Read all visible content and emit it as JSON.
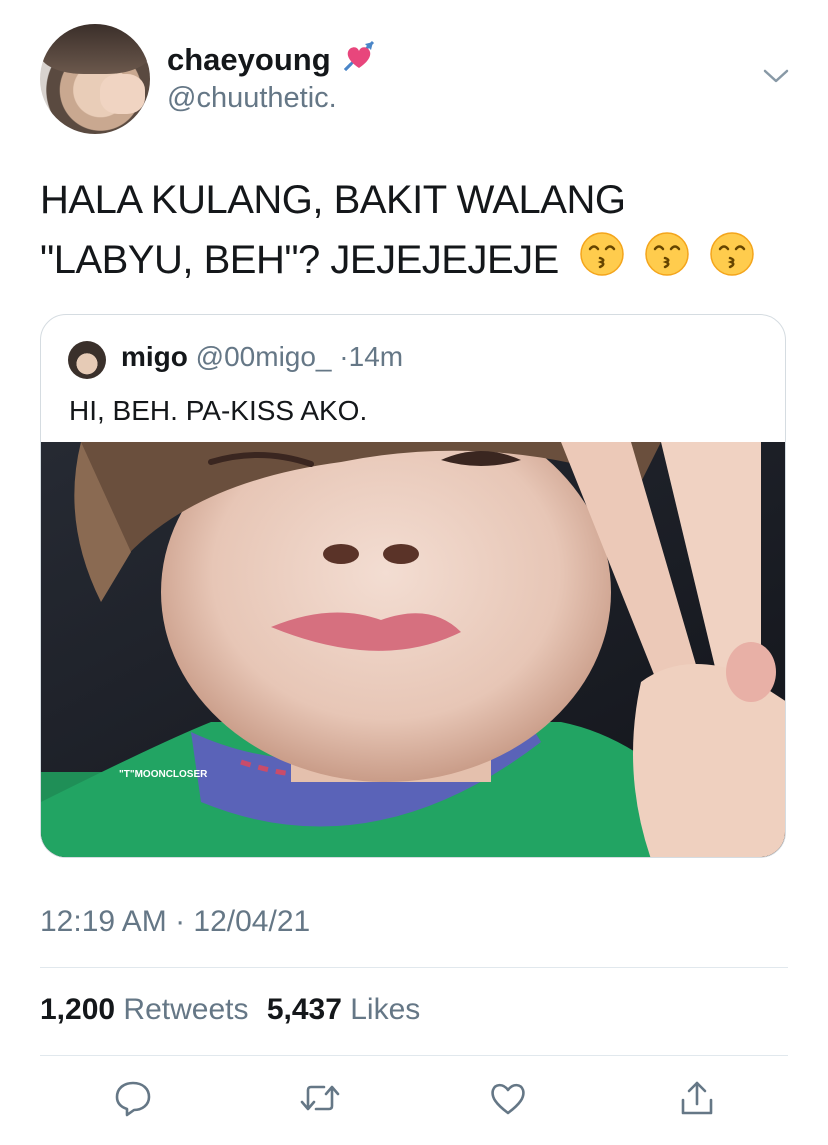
{
  "author": {
    "display_name": "chaeyoung",
    "name_emoji_icon": "heart-with-arrow-icon",
    "handle": "@chuuthetic."
  },
  "menu_icon": "chevron-down-icon",
  "tweet": {
    "line1": "HALA KULANG, BAKIT WALANG",
    "line2": "\"LABYU, BEH\"? JEJEJEJEJE",
    "emoji_icon": "kissing-face-with-smiling-eyes-icon"
  },
  "quoted": {
    "name": "migo",
    "handle": "@00migo_",
    "separator": "·",
    "time": "14m",
    "text": "HI, BEH. PA-KISS AKO.",
    "photo_watermark": "\"T\"MOONCLOSER"
  },
  "timestamp": "12:19 AM · 12/04/21",
  "stats": {
    "retweets_count": "1,200",
    "retweets_label": "Retweets",
    "likes_count": "5,437",
    "likes_label": "Likes"
  },
  "actions": [
    "reply-icon",
    "retweet-icon",
    "like-icon",
    "share-icon"
  ],
  "colors": {
    "text": "#14171a",
    "secondary": "#657786",
    "divider": "#e1e8ed",
    "border": "#d5dce1"
  }
}
